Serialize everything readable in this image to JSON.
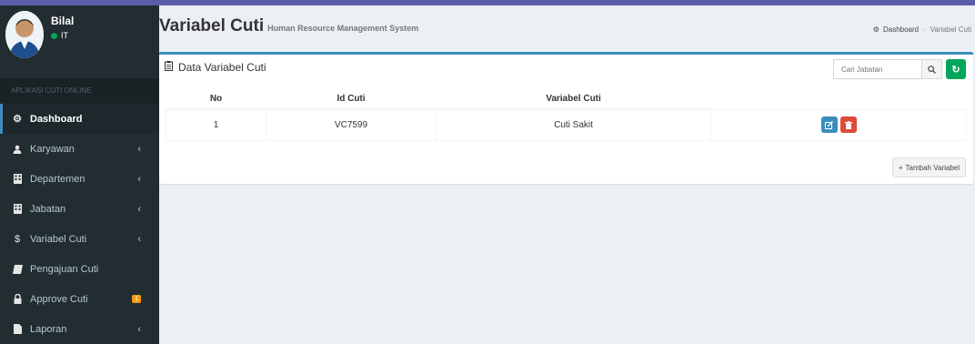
{
  "user": {
    "name": "Bilal",
    "status": "IT"
  },
  "sidebar": {
    "header": "APLIKASI CUTI ONLINE",
    "items": [
      {
        "label": "Dashboard",
        "icon": "dashboard-icon"
      },
      {
        "label": "Karyawan",
        "icon": "user-icon"
      },
      {
        "label": "Departemen",
        "icon": "building-icon"
      },
      {
        "label": "Jabatan",
        "icon": "building-icon"
      },
      {
        "label": "Variabel Cuti",
        "icon": "dollar-icon"
      },
      {
        "label": "Pengajuan Cuti",
        "icon": "book-icon"
      },
      {
        "label": "Approve Cuti",
        "icon": "lock-icon",
        "badge": "1"
      },
      {
        "label": "Laporan",
        "icon": "file-icon"
      }
    ]
  },
  "page": {
    "title": "Variabel Cuti",
    "subtitle": "Human Resource Management System"
  },
  "breadcrumb": {
    "home": "Dashboard",
    "current": "Variabel Cuti"
  },
  "box": {
    "title": "Data Variabel Cuti",
    "search_placeholder": "Cari Jabatan",
    "add_label": "Tambah Variabel"
  },
  "table": {
    "headers": [
      "No",
      "Id Cuti",
      "Variabel Cuti"
    ],
    "rows": [
      {
        "no": "1",
        "id": "VC7599",
        "variabel": "Cuti Sakit"
      }
    ]
  },
  "colors": {
    "sidebar": "#222d32",
    "accent": "#3c8dbc",
    "success": "#00a65a",
    "danger": "#dd4b39",
    "warning": "#f39c12"
  }
}
